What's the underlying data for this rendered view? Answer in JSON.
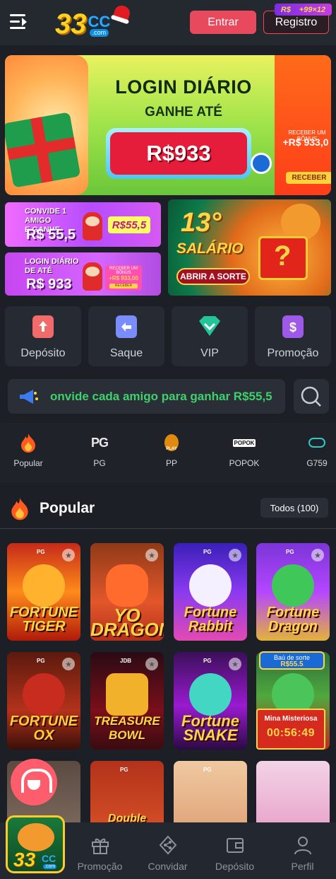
{
  "header": {
    "logo_number": "33",
    "logo_cc": "CC",
    "logo_com": ".com",
    "login_label": "Entrar",
    "register_label": "Registro",
    "register_badge_currency": "R$",
    "register_badge_value": "+99×12"
  },
  "banner": {
    "title": "LOGIN DIÁRIO",
    "subtitle": "GANHE ATÉ",
    "amount": "R$933",
    "side_label": "RECEBER UM BÔNUS",
    "side_amount": "+R$ 933,0",
    "side_button": "RECEBER"
  },
  "promos": {
    "invite": {
      "line1": "CONVIDE 1 AMIGO",
      "line2": "E GANHE",
      "amount": "R$ 55,5",
      "tag": "R$55,5"
    },
    "daily": {
      "line1": "LOGIN DIÁRIO",
      "line2": "DE ATÉ",
      "amount": "R$ 933",
      "card_label": "RECEBER UM BÔNUS",
      "card_amount": "+R$ 933,00",
      "card_button": "RECEBER"
    },
    "salary": {
      "number": "13°",
      "word": "SALÁRIO",
      "button": "ABRIR A SORTE"
    }
  },
  "quick_actions": [
    {
      "label": "Depósito"
    },
    {
      "label": "Saque"
    },
    {
      "label": "VIP"
    },
    {
      "label": "Promoção"
    }
  ],
  "marquee": {
    "text": "onvide cada amigo para ganhar R$55,5"
  },
  "categories": [
    {
      "label": "Popular"
    },
    {
      "label": "PG"
    },
    {
      "label": "PP"
    },
    {
      "label": "POPOK"
    },
    {
      "label": "G759"
    }
  ],
  "popular": {
    "title": "Popular",
    "all_label": "Todos",
    "count": "(100)"
  },
  "games": [
    {
      "name": "FORTUNE TIGER",
      "provider": "PG"
    },
    {
      "name": "YO DRAGON",
      "provider": ""
    },
    {
      "name": "Fortune Rabbit",
      "provider": "PG"
    },
    {
      "name": "Fortune Dragon",
      "provider": "PG"
    },
    {
      "name": "FORTUNE OX",
      "provider": "PG"
    },
    {
      "name": "TREASURE BOWL",
      "provider": "JDB"
    },
    {
      "name": "Fortune SNAKE",
      "provider": "PG"
    },
    {
      "name": "",
      "provider": ""
    },
    {
      "name": "",
      "provider": ""
    },
    {
      "name": "Double",
      "provider": "PG"
    },
    {
      "name": "",
      "provider": "PG"
    },
    {
      "name": "",
      "provider": ""
    }
  ],
  "overlays": {
    "chest_title": "Baú de sorte",
    "chest_amount": "R$55.5",
    "mina_title": "Mina Misteriosa",
    "mina_timer": "00:56:49"
  },
  "bottom_nav": [
    {
      "label": "Promoção"
    },
    {
      "label": "Convidar"
    },
    {
      "label": "Depósito"
    },
    {
      "label": "Perfil"
    }
  ],
  "colors": {
    "background": "#1c2026",
    "accent": "#e8495d",
    "marquee_text": "#3fd06b",
    "brand_yellow": "#ffd21f"
  }
}
